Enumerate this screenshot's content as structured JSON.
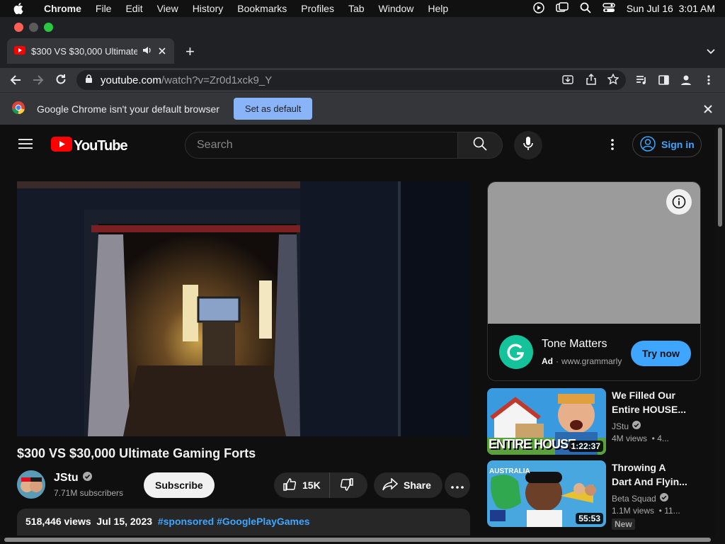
{
  "menubar": {
    "items": [
      "Chrome",
      "File",
      "Edit",
      "View",
      "History",
      "Bookmarks",
      "Profiles",
      "Tab",
      "Window",
      "Help"
    ],
    "datetime": "Sun Jul 16  3:01 AM"
  },
  "browser": {
    "tab_title": "$300 VS $30,000 Ultimate Gaming Forts",
    "url_domain": "youtube.com",
    "url_path": "/watch?v=Zr0d1xck9_Y",
    "infobar_text": "Google Chrome isn't your default browser",
    "set_default_label": "Set as default"
  },
  "youtube": {
    "logo_text": "YouTube",
    "search_placeholder": "Search",
    "signin_label": "Sign in",
    "video": {
      "title": "$300 VS $30,000 Ultimate Gaming Forts",
      "channel": "JStu",
      "subscribers": "7.71M subscribers",
      "subscribe_label": "Subscribe",
      "likes": "15K",
      "share_label": "Share",
      "views": "518,446 views",
      "date": "Jul 15, 2023",
      "tags": [
        "#sponsored",
        "#GooglePlayGames"
      ]
    },
    "ad": {
      "headline": "Tone Matters",
      "badge": "Ad",
      "domain": "www.grammarly",
      "cta": "Try now",
      "brand_color": "#15c39a"
    },
    "recommendations": [
      {
        "title_line1": "We Filled Our",
        "title_line2": "Entire HOUSE...",
        "channel": "JStu",
        "meta": "4M views  • 4...",
        "duration": "1:22:37",
        "thumb_text": "ENTIRE HOUSE",
        "badge": ""
      },
      {
        "title_line1": "Throwing A",
        "title_line2": "Dart And Flyin...",
        "channel": "Beta Squad",
        "meta": "1.1M views  • 11...",
        "duration": "55:53",
        "thumb_text": "AUSTRALIA",
        "badge": "New"
      }
    ]
  },
  "colors": {
    "accent": "#3ea6ff",
    "youtube_red": "#ff0000"
  }
}
